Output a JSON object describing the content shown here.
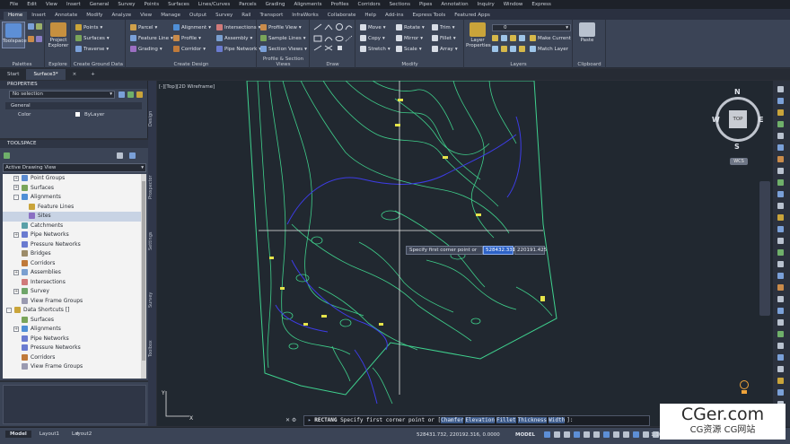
{
  "menu": [
    "File",
    "Edit",
    "View",
    "Insert",
    "General",
    "Survey",
    "Points",
    "Surfaces",
    "Lines/Curves",
    "Parcels",
    "Grading",
    "Alignments",
    "Profiles",
    "Corridors",
    "Sections",
    "Pipes",
    "Annotation",
    "Inquiry",
    "Window",
    "Express"
  ],
  "tabs": [
    "Home",
    "Insert",
    "Annotate",
    "Modify",
    "Analyze",
    "View",
    "Manage",
    "Output",
    "Survey",
    "Rail",
    "Transport",
    "InfraWorks",
    "Collaborate",
    "Help",
    "Add-ins",
    "Express Tools",
    "Featured Apps"
  ],
  "ribbon": {
    "toolspace": "Toolspace",
    "project_explorer": "Project Explorer",
    "palettes": "Palettes",
    "explore": "Explore",
    "create_ground": {
      "label": "Create Ground Data",
      "items": [
        "Points",
        "Surfaces",
        "Traverse"
      ]
    },
    "create_design": {
      "label": "Create Design",
      "items": [
        "Parcel",
        "Feature Line",
        "Grading",
        "Alignment",
        "Profile",
        "Corridor",
        "Intersections",
        "Assembly",
        "Pipe Network"
      ]
    },
    "profile_section": {
      "label": "Profile & Section Views",
      "items": [
        "Profile View",
        "Sample Lines",
        "Section Views"
      ]
    },
    "draw": "Draw",
    "modify": {
      "label": "Modify",
      "items": [
        "Move",
        "Copy",
        "Stretch",
        "Rotate",
        "Mirror",
        "Scale",
        "Trim",
        "Fillet",
        "Array"
      ]
    },
    "layers": {
      "label": "Layers",
      "layer_props": "Layer Properties",
      "current_layer": "0",
      "make_current": "Make Current",
      "match_layer": "Match Layer"
    },
    "clipboard": {
      "label": "Clipboard",
      "paste": "Paste"
    }
  },
  "doc_tabs": {
    "start": "Start",
    "file": "Surface3*"
  },
  "properties": {
    "title": "PROPERTIES",
    "selection": "No selection",
    "section": "General",
    "color_label": "Color",
    "color_value": "ByLayer"
  },
  "toolspace": {
    "title": "TOOLSPACE",
    "view": "Active Drawing View",
    "tree": [
      {
        "label": "Point Groups",
        "indent": 1,
        "toggle": "+",
        "color": "#5b8bd0"
      },
      {
        "label": "Surfaces",
        "indent": 1,
        "toggle": "+",
        "color": "#7aa55a"
      },
      {
        "label": "Alignments",
        "indent": 1,
        "toggle": "-",
        "color": "#4f8fd6"
      },
      {
        "label": "Feature Lines",
        "indent": 2,
        "toggle": "",
        "color": "#c9a43a"
      },
      {
        "label": "Sites",
        "indent": 2,
        "toggle": "",
        "color": "#8a6fc2",
        "selected": true
      },
      {
        "label": "Catchments",
        "indent": 1,
        "toggle": "",
        "color": "#5aa0a8"
      },
      {
        "label": "Pipe Networks",
        "indent": 1,
        "toggle": "+",
        "color": "#6a7bd0"
      },
      {
        "label": "Pressure Networks",
        "indent": 1,
        "toggle": "",
        "color": "#6a7bd0"
      },
      {
        "label": "Bridges",
        "indent": 1,
        "toggle": "",
        "color": "#9c8c6a"
      },
      {
        "label": "Corridors",
        "indent": 1,
        "toggle": "",
        "color": "#c07a3a"
      },
      {
        "label": "Assemblies",
        "indent": 1,
        "toggle": "+",
        "color": "#7a9fd0"
      },
      {
        "label": "Intersections",
        "indent": 1,
        "toggle": "",
        "color": "#d07a7a"
      },
      {
        "label": "Survey",
        "indent": 1,
        "toggle": "+",
        "color": "#6fa56a"
      },
      {
        "label": "View Frame Groups",
        "indent": 1,
        "toggle": "",
        "color": "#9a9ab0"
      },
      {
        "label": "Data Shortcuts []",
        "indent": 0,
        "toggle": "-",
        "color": "#c9a43a"
      },
      {
        "label": "Surfaces",
        "indent": 1,
        "toggle": "",
        "color": "#7aa55a"
      },
      {
        "label": "Alignments",
        "indent": 1,
        "toggle": "+",
        "color": "#4f8fd6"
      },
      {
        "label": "Pipe Networks",
        "indent": 1,
        "toggle": "",
        "color": "#6a7bd0"
      },
      {
        "label": "Pressure Networks",
        "indent": 1,
        "toggle": "",
        "color": "#6a7bd0"
      },
      {
        "label": "Corridors",
        "indent": 1,
        "toggle": "",
        "color": "#c07a3a"
      },
      {
        "label": "View Frame Groups",
        "indent": 1,
        "toggle": "",
        "color": "#9a9ab0"
      }
    ]
  },
  "side_tabs": [
    "Design",
    "Prospector",
    "Settings",
    "Survey",
    "Toolbox"
  ],
  "viewport": {
    "label": "[-][Top][2D Wireframe]",
    "viewcube": {
      "top": "TOP",
      "n": "N",
      "s": "S",
      "e": "E",
      "w": "W",
      "wcs": "WCS"
    },
    "tooltip": "Specify first corner point or",
    "coord_x": "528432.331",
    "coord_y": "220191.425"
  },
  "command": {
    "name": "RECTANG",
    "prompt": "Specify first corner point or [",
    "options": [
      "Chamfer",
      "Elevation",
      "Fillet",
      "Thickness",
      "Width"
    ],
    "end": "]:"
  },
  "status": {
    "coords": "528431.732, 220192.316, 0.0000",
    "model": "MODEL",
    "scale": "1:100"
  },
  "layout_tabs": [
    "Model",
    "Layout1",
    "Layout2"
  ],
  "watermark": {
    "main": "CGer.com",
    "sub": "CG资源 CG网站"
  }
}
